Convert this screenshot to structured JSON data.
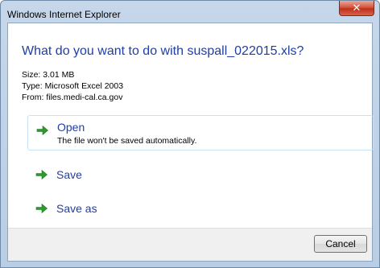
{
  "window": {
    "title": "Windows Internet Explorer",
    "close_icon": "close-icon"
  },
  "dialog": {
    "heading": "What do you want to do with suspall_022015.xls?",
    "size": "Size: 3.01 MB",
    "type": "Type: Microsoft Excel 2003",
    "from": "From: files.medi-cal.ca.gov"
  },
  "options": [
    {
      "label": "Open",
      "description": "The file won't be saved automatically.",
      "icon": "green-arrow-icon"
    },
    {
      "label": "Save",
      "icon": "green-arrow-icon"
    },
    {
      "label": "Save as",
      "icon": "green-arrow-icon"
    }
  ],
  "footer": {
    "cancel_label": "Cancel"
  },
  "colors": {
    "heading": "#1f3ea6",
    "arrow": "#2e9a2e",
    "close_button": "#c1301a"
  }
}
